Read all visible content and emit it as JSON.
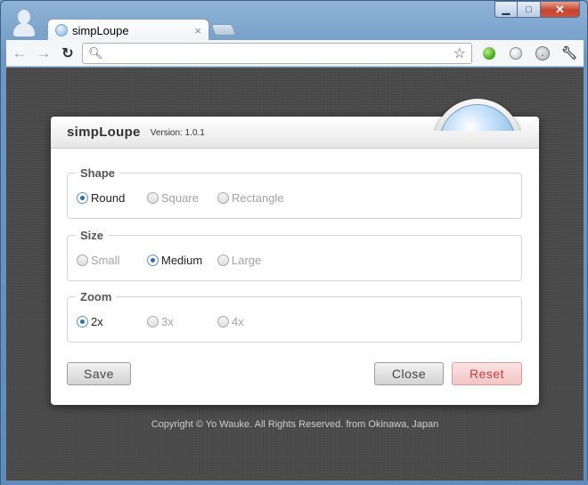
{
  "browser": {
    "tab_title": "simpLoupe",
    "tab_close": "×",
    "omnibox_value": ""
  },
  "icons": {
    "back": "back-arrow-icon",
    "forward": "forward-arrow-icon",
    "reload": "reload-icon",
    "search": "search-icon",
    "bookmark": "star-icon",
    "ext1": "green-ball-icon",
    "ext2": "loupe-icon",
    "ext3": "download-icon",
    "wrench": "wrench-icon"
  },
  "panel": {
    "title": "simpLoupe",
    "version": "Version: 1.0.1",
    "groups": [
      {
        "legend": "Shape",
        "options": [
          "Round",
          "Square",
          "Rectangle"
        ],
        "selected": "Round"
      },
      {
        "legend": "Size",
        "options": [
          "Small",
          "Medium",
          "Large"
        ],
        "selected": "Medium"
      },
      {
        "legend": "Zoom",
        "options": [
          "2x",
          "3x",
          "4x"
        ],
        "selected": "2x"
      }
    ],
    "buttons": {
      "save": "Save",
      "close": "Close",
      "reset": "Reset"
    }
  },
  "footer": "Copyright © Yo Wauke. All Rights Reserved. from Okinawa, Japan",
  "colors": {
    "selected_radio": "#2a6db2",
    "reset_text": "#c04040",
    "page_background": "#4a4a4b"
  }
}
